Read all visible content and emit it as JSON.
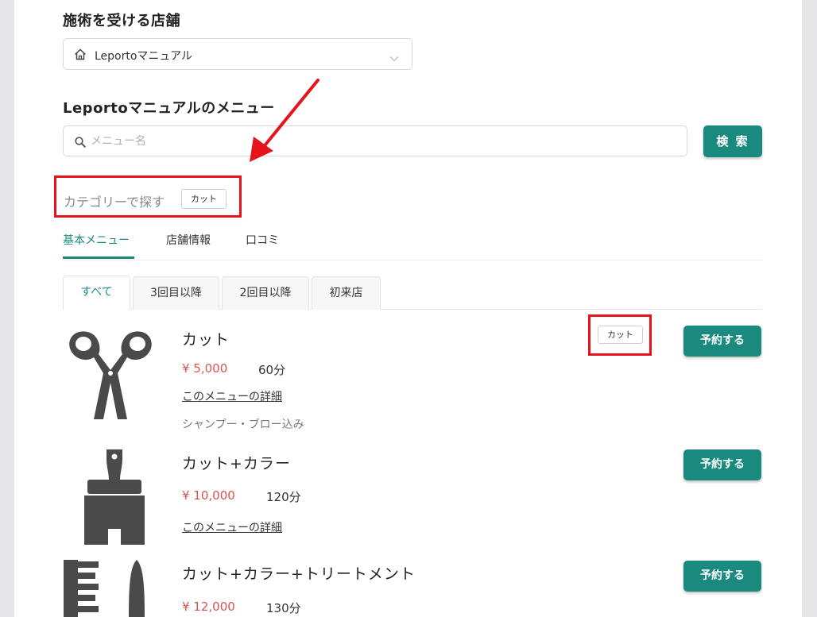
{
  "store_section": {
    "title": "施術を受ける店舗",
    "selected_store": "Leportoマニュアル"
  },
  "menu_section": {
    "title": "Leportoマニュアルのメニュー",
    "search_placeholder": "メニュー名",
    "search_button": "検 索"
  },
  "category": {
    "label": "カテゴリーで探す",
    "tag": "カット"
  },
  "main_tabs": [
    {
      "label": "基本メニュー",
      "active": true
    },
    {
      "label": "店舗情報",
      "active": false
    },
    {
      "label": "口コミ",
      "active": false
    }
  ],
  "sub_tabs": [
    {
      "label": "すべて",
      "active": true
    },
    {
      "label": "3回目以降",
      "active": false
    },
    {
      "label": "2回目以降",
      "active": false
    },
    {
      "label": "初来店",
      "active": false
    }
  ],
  "menu_items": [
    {
      "name": "カット",
      "price": "¥ 5,000",
      "duration": "60分",
      "detail_link": "このメニューの詳細",
      "note": "シャンプー・ブロー込み",
      "tag": "カット",
      "reserve": "予約する",
      "icon": "scissors-icon"
    },
    {
      "name": "カット+カラー",
      "price": "¥ 10,000",
      "duration": "120分",
      "detail_link": "このメニューの詳細",
      "reserve": "予約する",
      "icon": "paint-brush-icon"
    },
    {
      "name": "カット+カラー+トリートメント",
      "price": "¥ 12,000",
      "duration": "130分",
      "reserve": "予約する",
      "icon": "comb-icon"
    }
  ],
  "colors": {
    "accent": "#1a8a7f",
    "price": "#d9534f",
    "highlight": "#e5141b"
  }
}
